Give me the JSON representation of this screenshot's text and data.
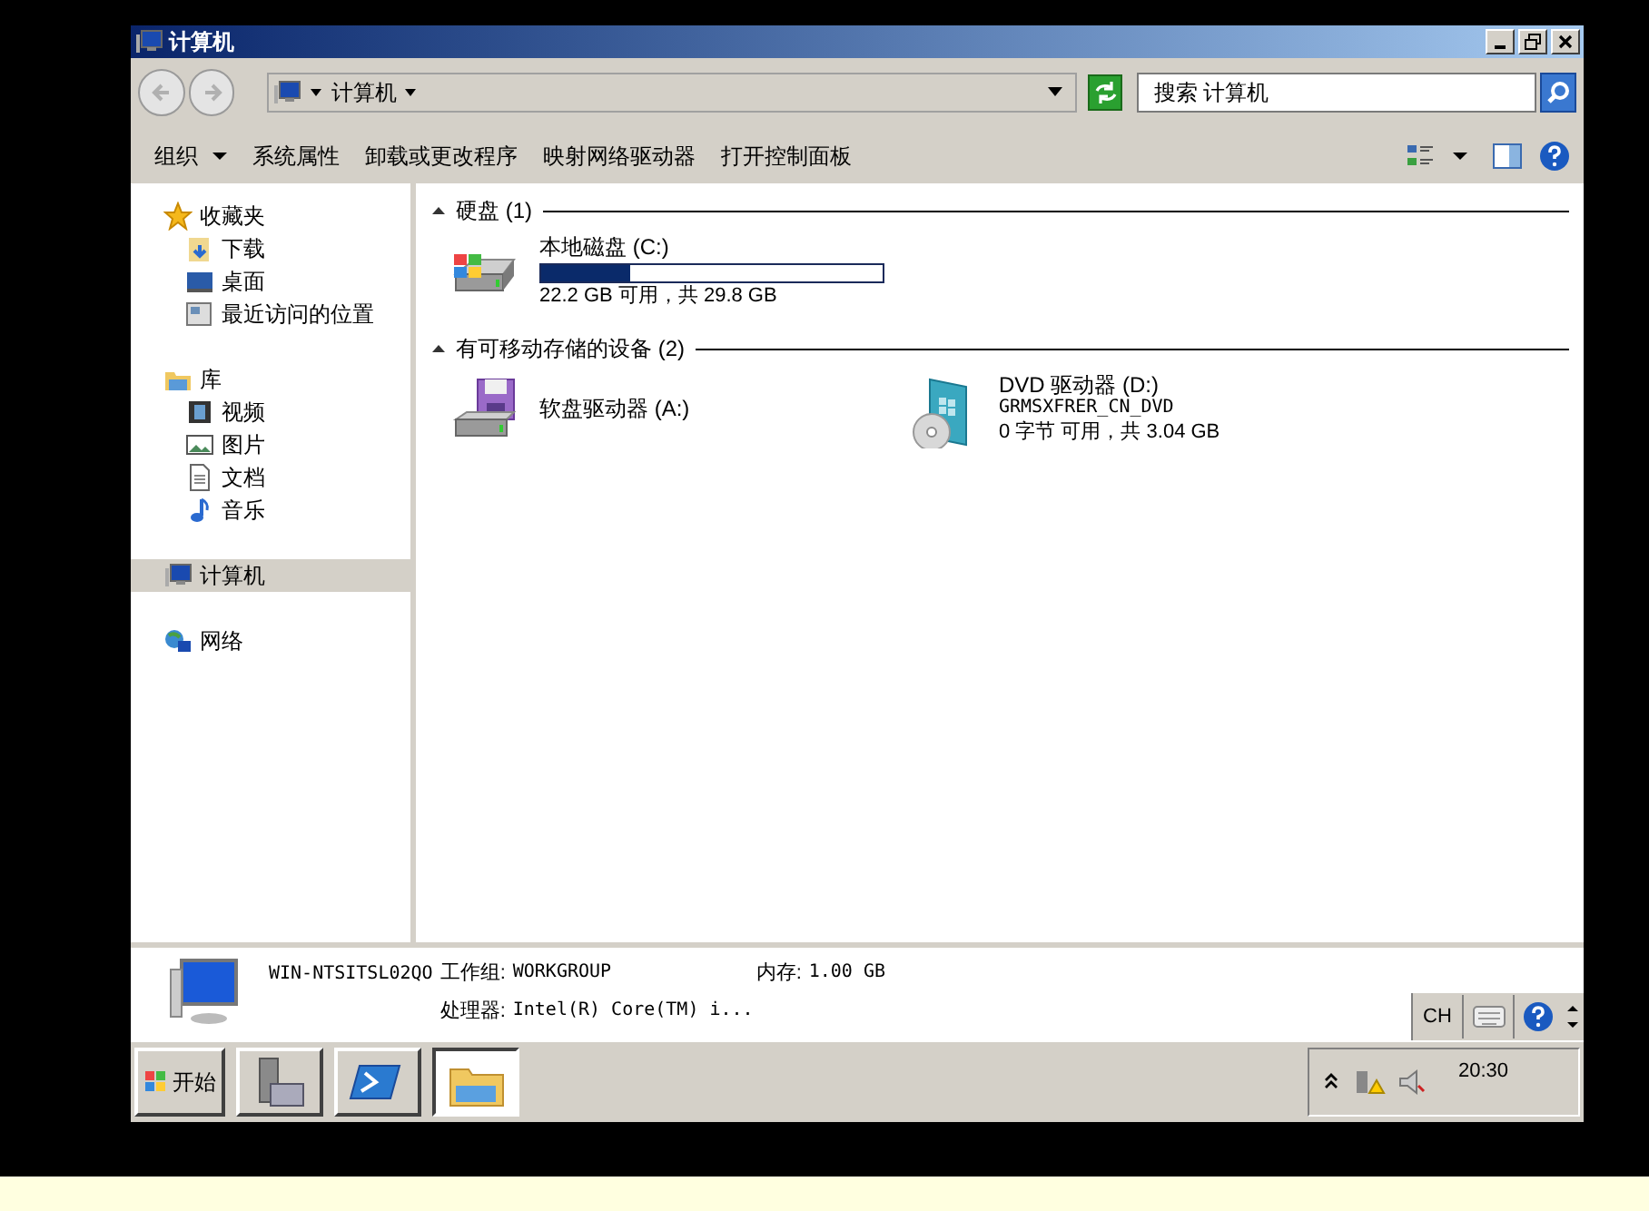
{
  "window": {
    "title": "计算机"
  },
  "address_bar": {
    "path": "计算机",
    "search_placeholder": "搜索 计算机"
  },
  "toolbar": {
    "items": [
      {
        "label": "组织",
        "has_menu": true
      },
      {
        "label": "系统属性",
        "has_menu": false
      },
      {
        "label": "卸载或更改程序",
        "has_menu": false
      },
      {
        "label": "映射网络驱动器",
        "has_menu": false
      },
      {
        "label": "打开控制面板",
        "has_menu": false
      }
    ]
  },
  "sidebar": {
    "groups": [
      {
        "label": "收藏夹",
        "selected": false,
        "children": [
          {
            "label": "下载",
            "selected": false
          },
          {
            "label": "桌面",
            "selected": false
          },
          {
            "label": "最近访问的位置",
            "selected": false
          }
        ]
      },
      {
        "label": "库",
        "selected": false,
        "children": [
          {
            "label": "视频",
            "selected": false
          },
          {
            "label": "图片",
            "selected": false
          },
          {
            "label": "文档",
            "selected": false
          },
          {
            "label": "音乐",
            "selected": false
          }
        ]
      },
      {
        "label": "计算机",
        "selected": true
      },
      {
        "label": "网络",
        "selected": false
      }
    ]
  },
  "content": {
    "groups": [
      {
        "title": "硬盘",
        "count": "(1)",
        "expanded": true,
        "items": [
          {
            "kind": "hdd",
            "name": "本地磁盘 (C:)",
            "level": 0.26,
            "info": "22.2 GB 可用，共 29.8 GB"
          }
        ]
      },
      {
        "title": "有可移动存储的设备",
        "count": "(2)",
        "expanded": true,
        "items": [
          {
            "kind": "floppy",
            "name": "软盘驱动器 (A:)"
          },
          {
            "kind": "dvd",
            "name": "DVD 驱动器 (D:)",
            "label": "GRMSXFRER_CN_DVD",
            "info": "0 字节 可用，共 3.04 GB"
          }
        ]
      }
    ]
  },
  "details": {
    "computer_name": "WIN-NTSITSL02QO",
    "fields": [
      {
        "label": "工作组:",
        "value": "WORKGROUP"
      },
      {
        "label": "内存:",
        "value": "1.00 GB"
      },
      {
        "label": "处理器:",
        "value": "Intel(R) Core(TM) i..."
      }
    ]
  },
  "language_bar": {
    "language": "CH"
  },
  "taskbar": {
    "start": "开始",
    "apps": [
      {
        "selected": false
      },
      {
        "selected": false
      },
      {
        "selected": true
      }
    ],
    "clock": "20:30"
  }
}
